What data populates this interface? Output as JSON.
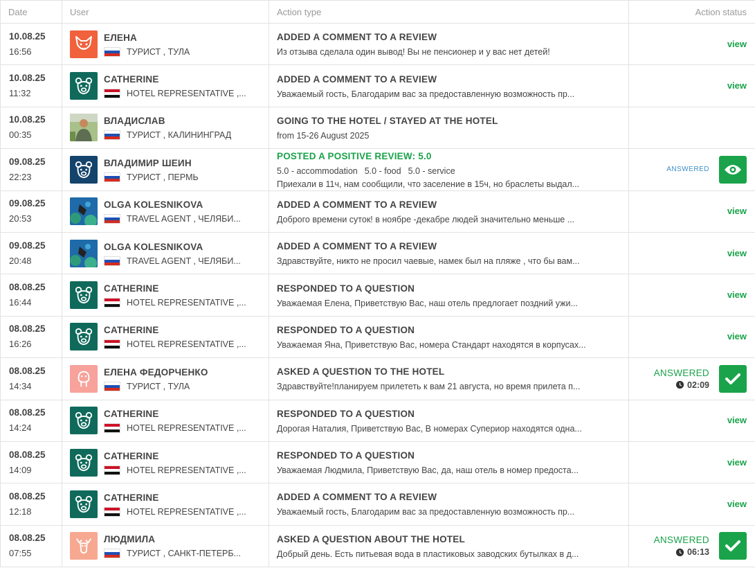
{
  "header": {
    "date": "Date",
    "user": "User",
    "action_type": "Action type",
    "action_status": "Action status"
  },
  "colors": {
    "green": "#1aa34a",
    "blue": "#3a8fc8",
    "teal": "#106a5b",
    "fox": "#f0613c"
  },
  "rows": [
    {
      "date": "10.08.25",
      "time": "16:56",
      "avatar": "fox-icon",
      "name": "ЕЛЕНА",
      "flag": "ru",
      "role": "ТУРИСТ , ТУЛА",
      "action": "ADDED A COMMENT TO A REVIEW",
      "desc": "Из отзыва сделала один вывод! Вы не пенсионер и у вас нет детей!",
      "status": "view"
    },
    {
      "date": "10.08.25",
      "time": "11:32",
      "avatar": "bear-icon",
      "name": "CATHERINE",
      "flag": "eg",
      "role": "HOTEL REPRESENTATIVE ,...",
      "action": "ADDED A COMMENT TO A REVIEW",
      "desc": "Уважаемый гость, Благодарим вас за предоставленную возможность пр...",
      "status": "view"
    },
    {
      "date": "10.08.25",
      "time": "00:35",
      "avatar": "photo-avatar",
      "name": "ВЛАДИСЛАВ",
      "flag": "ru",
      "role": "ТУРИСТ , КАЛИНИНГРАД",
      "action": "GOING TO THE HOTEL / STAYED AT THE HOTEL",
      "desc": "from 15-26 August 2025",
      "status": ""
    },
    {
      "date": "09.08.25",
      "time": "22:23",
      "avatar": "bear-outline-icon",
      "name": "ВЛАДИМИР ШЕИН",
      "flag": "ru",
      "role": "ТУРИСТ , ПЕРМЬ",
      "action": "POSTED A POSITIVE REVIEW: 5.0",
      "scores": [
        "5.0 - accommodation",
        "5.0 - food",
        "5.0 - service"
      ],
      "desc": "Приехали в 11ч, нам сообщили, что заселение в 15ч, но браслеты выдал...",
      "status": "ANSWERED",
      "status_icon": "eye-icon"
    },
    {
      "date": "09.08.25",
      "time": "20:53",
      "avatar": "diver-photo",
      "name": "OLGA KOLESNIKOVA",
      "flag": "ru",
      "role": "TRAVEL AGENT , ЧЕЛЯБИ...",
      "action": "ADDED A COMMENT TO A REVIEW",
      "desc": "Доброго времени суток! в ноябре -декабре людей значительно меньше ...",
      "status": "view"
    },
    {
      "date": "09.08.25",
      "time": "20:48",
      "avatar": "diver-photo",
      "name": "OLGA KOLESNIKOVA",
      "flag": "ru",
      "role": "TRAVEL AGENT , ЧЕЛЯБИ...",
      "action": "ADDED A COMMENT TO A REVIEW",
      "desc": "Здравствуйте, никто не просил чаевые, намек был на пляже , что бы вам...",
      "status": "view"
    },
    {
      "date": "08.08.25",
      "time": "16:44",
      "avatar": "bear-icon",
      "name": "CATHERINE",
      "flag": "eg",
      "role": "HOTEL REPRESENTATIVE ,...",
      "action": "RESPONDED TO A QUESTION",
      "desc": "Уважаемая Елена, Приветствую Вас, наш отель предлогает поздний ужи...",
      "status": "view"
    },
    {
      "date": "08.08.25",
      "time": "16:26",
      "avatar": "bear-icon",
      "name": "CATHERINE",
      "flag": "eg",
      "role": "HOTEL REPRESENTATIVE ,...",
      "action": "RESPONDED TO A QUESTION",
      "desc": "Уважаемая Яна, Приветствую Вас, номера Стандарт находятся в корпусах...",
      "status": "view"
    },
    {
      "date": "08.08.25",
      "time": "14:34",
      "avatar": "walrus-icon",
      "name": "ЕЛЕНА ФЕДОРЧЕНКО",
      "flag": "ru",
      "role": "ТУРИСТ , ТУЛА",
      "action": "ASKED A QUESTION TO THE HOTEL",
      "desc": "Здравствуйте!планируем прилететь к вам 21 августа, но время прилета п...",
      "status": "ANSWERED",
      "answer_time": "02:09",
      "status_icon": "check-icon"
    },
    {
      "date": "08.08.25",
      "time": "14:24",
      "avatar": "bear-icon",
      "name": "CATHERINE",
      "flag": "eg",
      "role": "HOTEL REPRESENTATIVE ,...",
      "action": "RESPONDED TO A QUESTION",
      "desc": "Дорогая Наталия, Приветствую Вас, В номерах Супериор находятся одна...",
      "status": "view"
    },
    {
      "date": "08.08.25",
      "time": "14:09",
      "avatar": "bear-icon",
      "name": "CATHERINE",
      "flag": "eg",
      "role": "HOTEL REPRESENTATIVE ,...",
      "action": "RESPONDED TO A QUESTION",
      "desc": "Уважаемая Людмила, Приветствую Вас, да, наш отель в номер предоста...",
      "status": "view"
    },
    {
      "date": "08.08.25",
      "time": "12:18",
      "avatar": "bear-icon",
      "name": "CATHERINE",
      "flag": "eg",
      "role": "HOTEL REPRESENTATIVE ,...",
      "action": "ADDED A COMMENT TO A REVIEW",
      "desc": "Уважаемый гость, Благодарим вас за предоставленную возможность пр...",
      "status": "view"
    },
    {
      "date": "08.08.25",
      "time": "07:55",
      "avatar": "moose-icon",
      "name": "ЛЮДМИЛА",
      "flag": "ru",
      "role": "ТУРИСТ , САНКТ-ПЕТЕРБ...",
      "action": "ASKED A QUESTION ABOUT THE HOTEL",
      "desc": "Добрый день. Есть питьевая вода в пластиковых заводских бутылках в д...",
      "status": "ANSWERED",
      "answer_time": "06:13",
      "status_icon": "check-icon"
    }
  ]
}
